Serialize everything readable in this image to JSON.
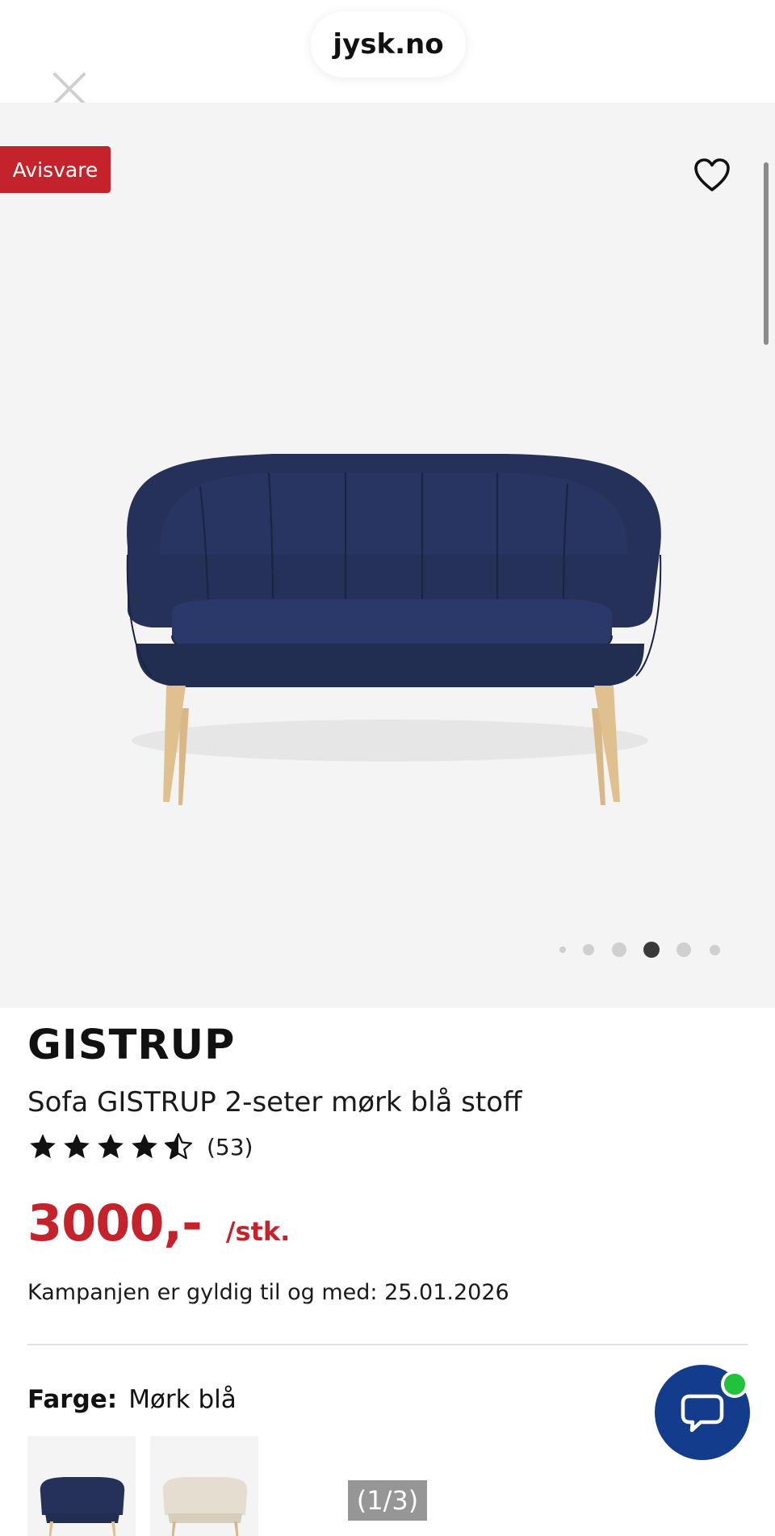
{
  "browser": {
    "url": "jysk.no"
  },
  "icons": {
    "close": "close-icon",
    "favorite": "heart-icon",
    "chat": "chat-bubble-icon",
    "star": "star-icon"
  },
  "gallery": {
    "badge": "Avisvare",
    "active_dot": 4,
    "dot_count": 6
  },
  "product": {
    "brand": "GISTRUP",
    "title": "Sofa GISTRUP 2-seter mørk blå stoff",
    "rating": {
      "value": 4.5,
      "max": 5,
      "count_label": "(53)"
    },
    "price": "3000,-",
    "price_unit": "/stk.",
    "campaign_text": "Kampanjen er gyldig til og med: 25.01.2026"
  },
  "color_selector": {
    "label": "Farge:",
    "value": "Mørk blå",
    "options": [
      "Mørk blå",
      "Beige"
    ]
  },
  "image_counter": "(1/3)",
  "colors": {
    "accent": "#c5232b",
    "chat": "#143c8c",
    "online": "#22c33c",
    "sofa_blue": "#24305a",
    "wood": "#e0c08f"
  }
}
